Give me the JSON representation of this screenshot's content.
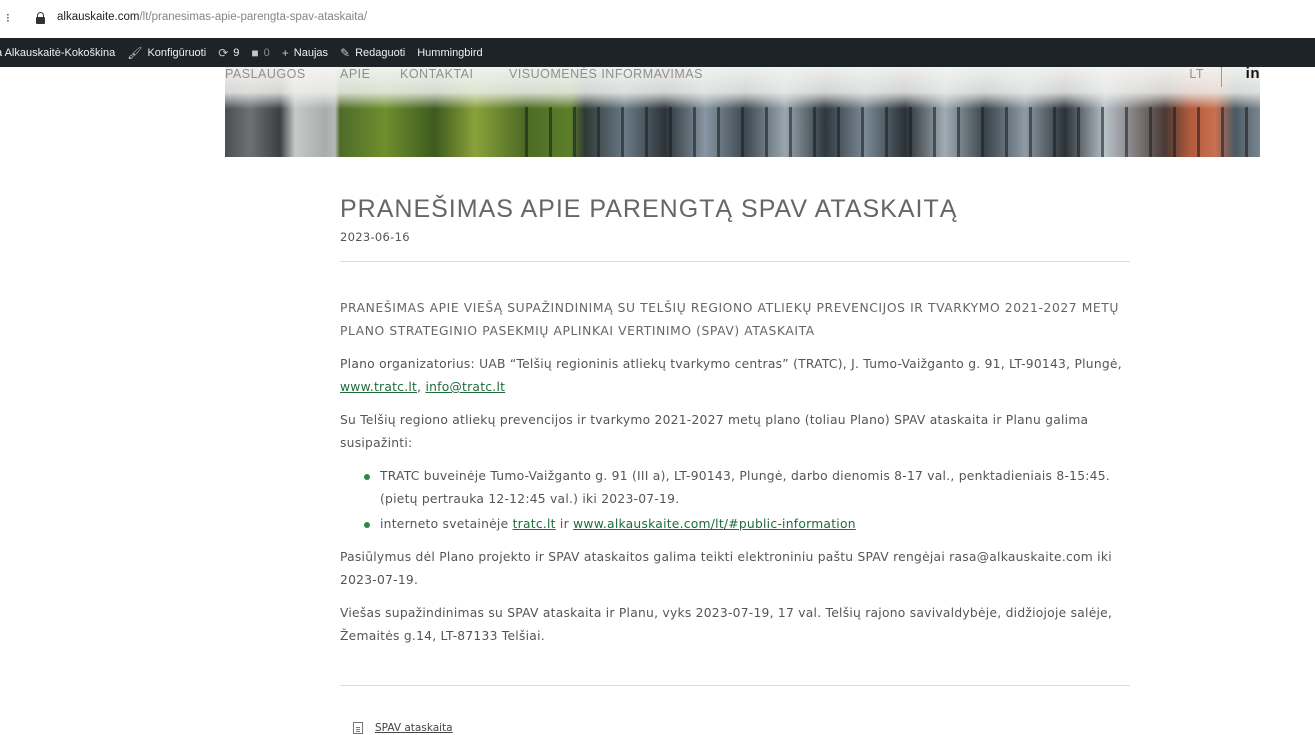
{
  "browser": {
    "menu_glyph": "⁝",
    "url_domain": "alkauskaite.com",
    "url_path": "/lt/pranesimas-apie-parengta-spav-ataskaita/"
  },
  "adminbar": {
    "user": "a Alkauskaitė-Kokoškina",
    "customize": "Konfigūruoti",
    "updates_count": "9",
    "comments_count": "0",
    "new": "Naujas",
    "edit": "Redaguoti",
    "hummingbird": "Hummingbird"
  },
  "nav": {
    "items": [
      "PASLAUGOS",
      "APIE",
      "KONTAKTAI",
      "VISUOMENĖS INFORMAVIMAS"
    ],
    "language": "LT",
    "linkedin": "in"
  },
  "article": {
    "title": "PRANEŠIMAS APIE PARENGTĄ SPAV ATASKAITĄ",
    "date": "2023-06-16",
    "lead": "PRANEŠIMAS APIE VIEŠĄ SUPAŽINDINIMĄ SU TELŠIŲ REGIONO ATLIEKŲ PREVENCIJOS IR TVARKYMO 2021-2027 METŲ PLANO STRATEGINIO PASEKMIŲ APLINKAI VERTINIMO (SPAV) ATASKAITA",
    "organizer_text": "Plano organizatorius: UAB “Telšių regioninis atliekų tvarkymo centras” (TRATC), J. Tumo-Vaižganto g. 91, LT-90143, Plungė,",
    "organizer_link_site": "www.tratc.lt",
    "organizer_separator": ",",
    "organizer_link_email": "info@tratc.lt",
    "intro": "Su Telšių regiono atliekų prevencijos ir tvarkymo 2021-2027 metų plano (toliau Plano) SPAV ataskaita ir Planu galima susipažinti:",
    "bullet1": "TRATC buveinėje Tumo-Vaižganto g. 91 (III a), LT-90143, Plungė, darbo dienomis 8-17 val., penktadieniais 8-15:45. (pietų pertrauka 12-12:45 val.) iki 2023-07-19.",
    "bullet2_prefix": "interneto svetainėje",
    "bullet2_link1": "tratc.lt",
    "bullet2_mid": "ir",
    "bullet2_link2": "www.alkauskaite.com/lt/#public-information",
    "proposals": "Pasiūlymus dėl Plano projekto ir SPAV ataskaitos galima teikti elektroniniu paštu SPAV rengėjai rasa@alkauskaite.com iki 2023-07-19.",
    "meeting": "Viešas supažindinimas su SPAV ataskaita ir Planu, vyks 2023-07-19, 17 val. Telšių rajono savivaldybėje, didžiojoje salėje, Žemaitės g.14, LT-87133 Telšiai.",
    "attachment": "SPAV ataskaita"
  }
}
